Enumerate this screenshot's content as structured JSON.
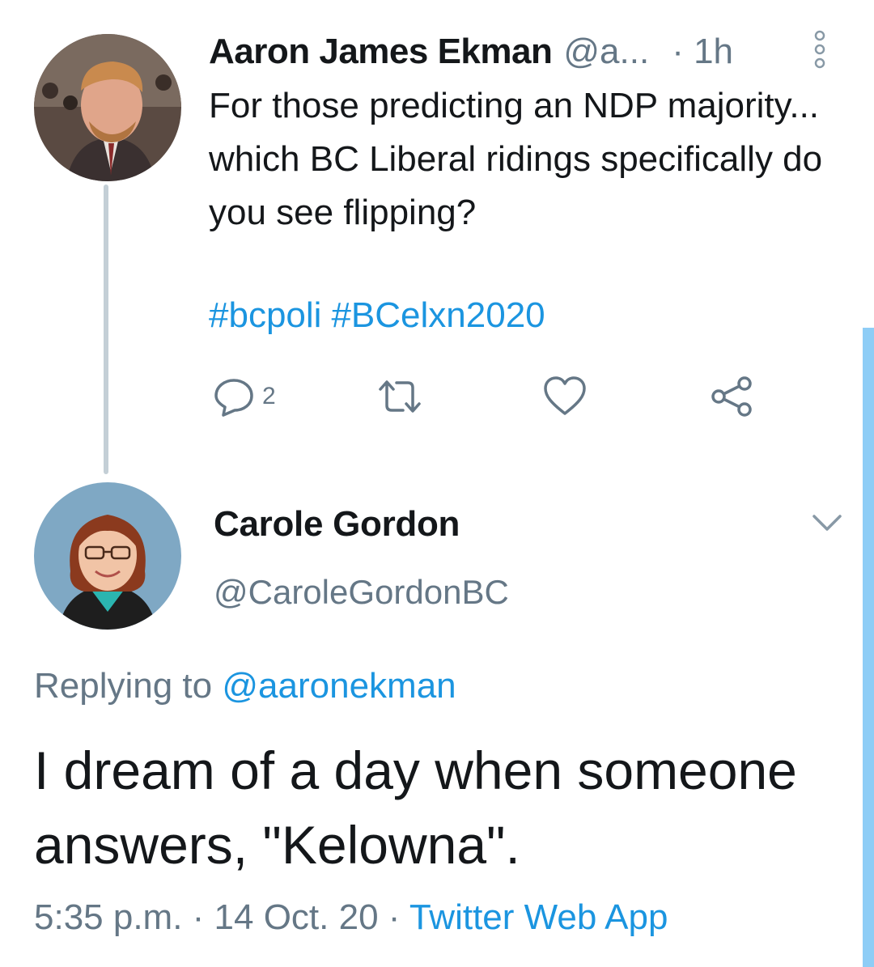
{
  "parent_tweet": {
    "name": "Aaron James Ekman",
    "handle": "@a...",
    "time_sep": "·",
    "time": "1h",
    "text": "For those predicting an NDP majority... which BC Liberal ridings specifically do you see flipping?",
    "hashtags": [
      "#bcpoli",
      "#BCelxn2020"
    ],
    "reply_count": "2"
  },
  "reply_tweet": {
    "name": "Carole Gordon",
    "handle": "@CaroleGordonBC",
    "replying_to_label": "Replying to",
    "replying_to_handle": "@aaronekman",
    "text": "I dream of a day when someone answers, \"Kelowna\".",
    "timestamp": "5:35 p.m. · 14 Oct. 20 ·",
    "source": "Twitter Web App"
  },
  "colors": {
    "link": "#1b95e0",
    "secondary_text": "#657786",
    "primary_text": "#14171a",
    "thread_line": "#c4cfd6",
    "scrollbar": "#8ecdf6"
  },
  "icons": {
    "reply": "comment-icon",
    "retweet": "retweet-icon",
    "like": "heart-icon",
    "share": "share-icon",
    "more": "more-options-icon",
    "caret": "chevron-down-icon"
  }
}
